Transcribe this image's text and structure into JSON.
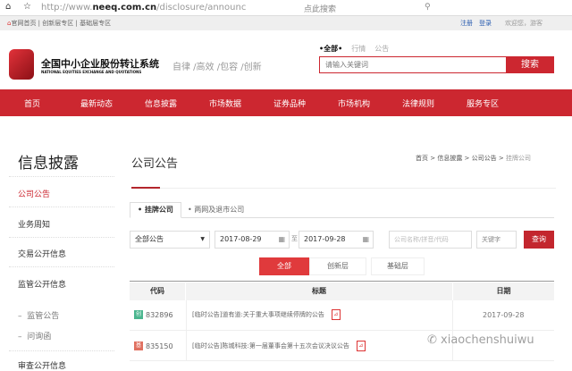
{
  "browser": {
    "url_prefix": "http://www.",
    "url_domain": "neeq.com.cn",
    "url_path": "/disclosure/announc",
    "search_placeholder": "点此搜索"
  },
  "bookmarks": {
    "links": "官网首页 | 创新层专区 | 基础层专区",
    "register": "注册",
    "login": "登录",
    "welcome": "欢迎您，游客"
  },
  "header": {
    "logo_cn": "全国中小企业股份转让系统",
    "logo_en": "NATIONAL EQUITIES EXCHANGE AND QUOTATIONS",
    "slogan": "自律 /高效 /包容 /创新",
    "search_tabs": [
      "•全部•",
      "行情",
      "公告"
    ],
    "search_placeholder": "请输入关键词",
    "search_button": "搜索"
  },
  "nav": [
    "首页",
    "最新动态",
    "信息披露",
    "市场数据",
    "证券品种",
    "市场机构",
    "法律规则",
    "服务专区"
  ],
  "sidebar": {
    "title": "信息披露",
    "items": [
      "公司公告",
      "业务周知",
      "交易公开信息",
      "监管公开信息"
    ],
    "sub_items": [
      "监管公告",
      "问询函"
    ],
    "last": "审查公开信息"
  },
  "main": {
    "title": "公司公告",
    "breadcrumb": [
      "首页",
      "信息披露",
      "公司公告",
      "挂牌公司"
    ],
    "tabs": [
      "• 挂牌公司",
      "• 两网及退市公司"
    ],
    "filters": {
      "type": "全部公告",
      "date_from": "2017-08-29",
      "to": "至",
      "date_to": "2017-09-28",
      "company_placeholder": "公司名称/拼音/代码",
      "keyword_placeholder": "关键字",
      "query": "查询"
    },
    "segments": [
      "全部",
      "创新层",
      "基础层"
    ],
    "table": {
      "headers": [
        "代码",
        "标题",
        "日期"
      ],
      "rows": [
        {
          "badge": "创",
          "code": "832896",
          "title": "[临时公告]道有道:关于重大事项继续停牌的公告",
          "date": "2017-09-28"
        },
        {
          "badge": "基",
          "code": "835150",
          "title": "[临时公告]陈城科技:第一届董事会第十五次会议决议公告",
          "date": ""
        }
      ]
    }
  },
  "watermark": "xiaochenshuiwu",
  "colors": {
    "brand_red": "#cc2730"
  }
}
